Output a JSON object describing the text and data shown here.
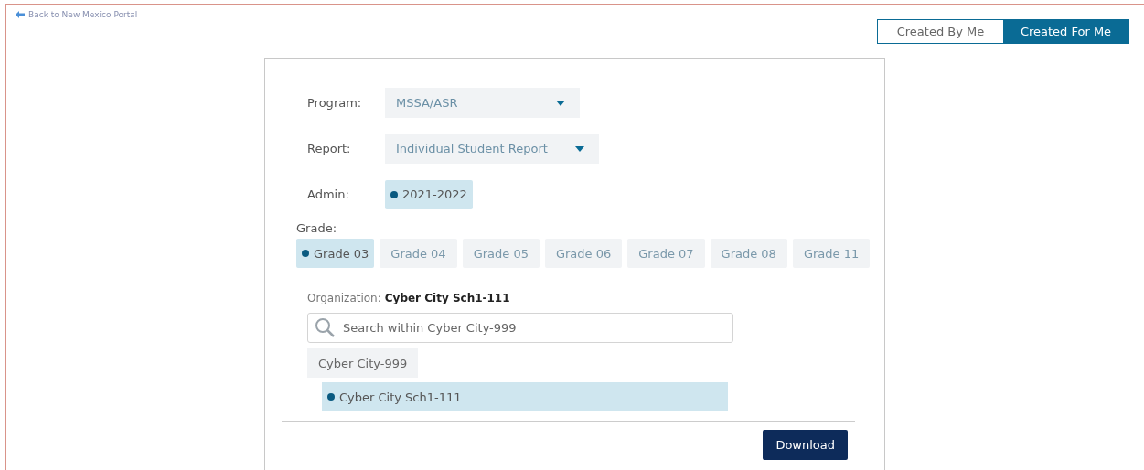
{
  "back_link": "Back to New Mexico Portal",
  "view_tabs": [
    {
      "label": "Created By Me",
      "selected": false
    },
    {
      "label": "Created For Me",
      "selected": true
    }
  ],
  "program": {
    "label": "Program:",
    "value": "MSSA/ASR"
  },
  "report": {
    "label": "Report:",
    "value": "Individual Student Report"
  },
  "admin": {
    "label": "Admin:",
    "options": [
      {
        "label": "2021-2022",
        "selected": true
      }
    ]
  },
  "grade": {
    "label": "Grade:",
    "options": [
      {
        "label": "Grade 03",
        "selected": true
      },
      {
        "label": "Grade 04",
        "selected": false
      },
      {
        "label": "Grade 05",
        "selected": false
      },
      {
        "label": "Grade 06",
        "selected": false
      },
      {
        "label": "Grade 07",
        "selected": false
      },
      {
        "label": "Grade 08",
        "selected": false
      },
      {
        "label": "Grade 11",
        "selected": false
      }
    ]
  },
  "organization": {
    "label": "Organization:",
    "value": "Cyber City Sch1-111",
    "search_placeholder": "Search within Cyber City-999",
    "tree": [
      {
        "label": "Cyber City-999",
        "selected": false,
        "children": [
          {
            "label": "Cyber City Sch1-111",
            "selected": true
          }
        ]
      }
    ]
  },
  "download_button": "Download"
}
